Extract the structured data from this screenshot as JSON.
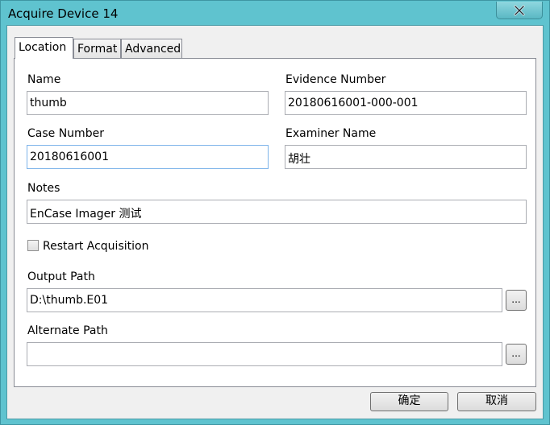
{
  "window": {
    "title": "Acquire Device 14"
  },
  "tabs": [
    "Location",
    "Format",
    "Advanced"
  ],
  "form": {
    "name_label": "Name",
    "name_value": "thumb",
    "evidence_label": "Evidence Number",
    "evidence_value": "20180616001-000-001",
    "case_label": "Case Number",
    "case_value": "20180616001",
    "examiner_label": "Examiner Name",
    "examiner_value": "胡壮",
    "notes_label": "Notes",
    "notes_value": "EnCase Imager 测试",
    "restart_label": "Restart Acquisition",
    "restart_checked": false,
    "output_label": "Output Path",
    "output_value": "D:\\thumb.E01",
    "alternate_label": "Alternate Path",
    "alternate_value": "",
    "browse_label": "..."
  },
  "buttons": {
    "ok": "确定",
    "cancel": "取消"
  }
}
